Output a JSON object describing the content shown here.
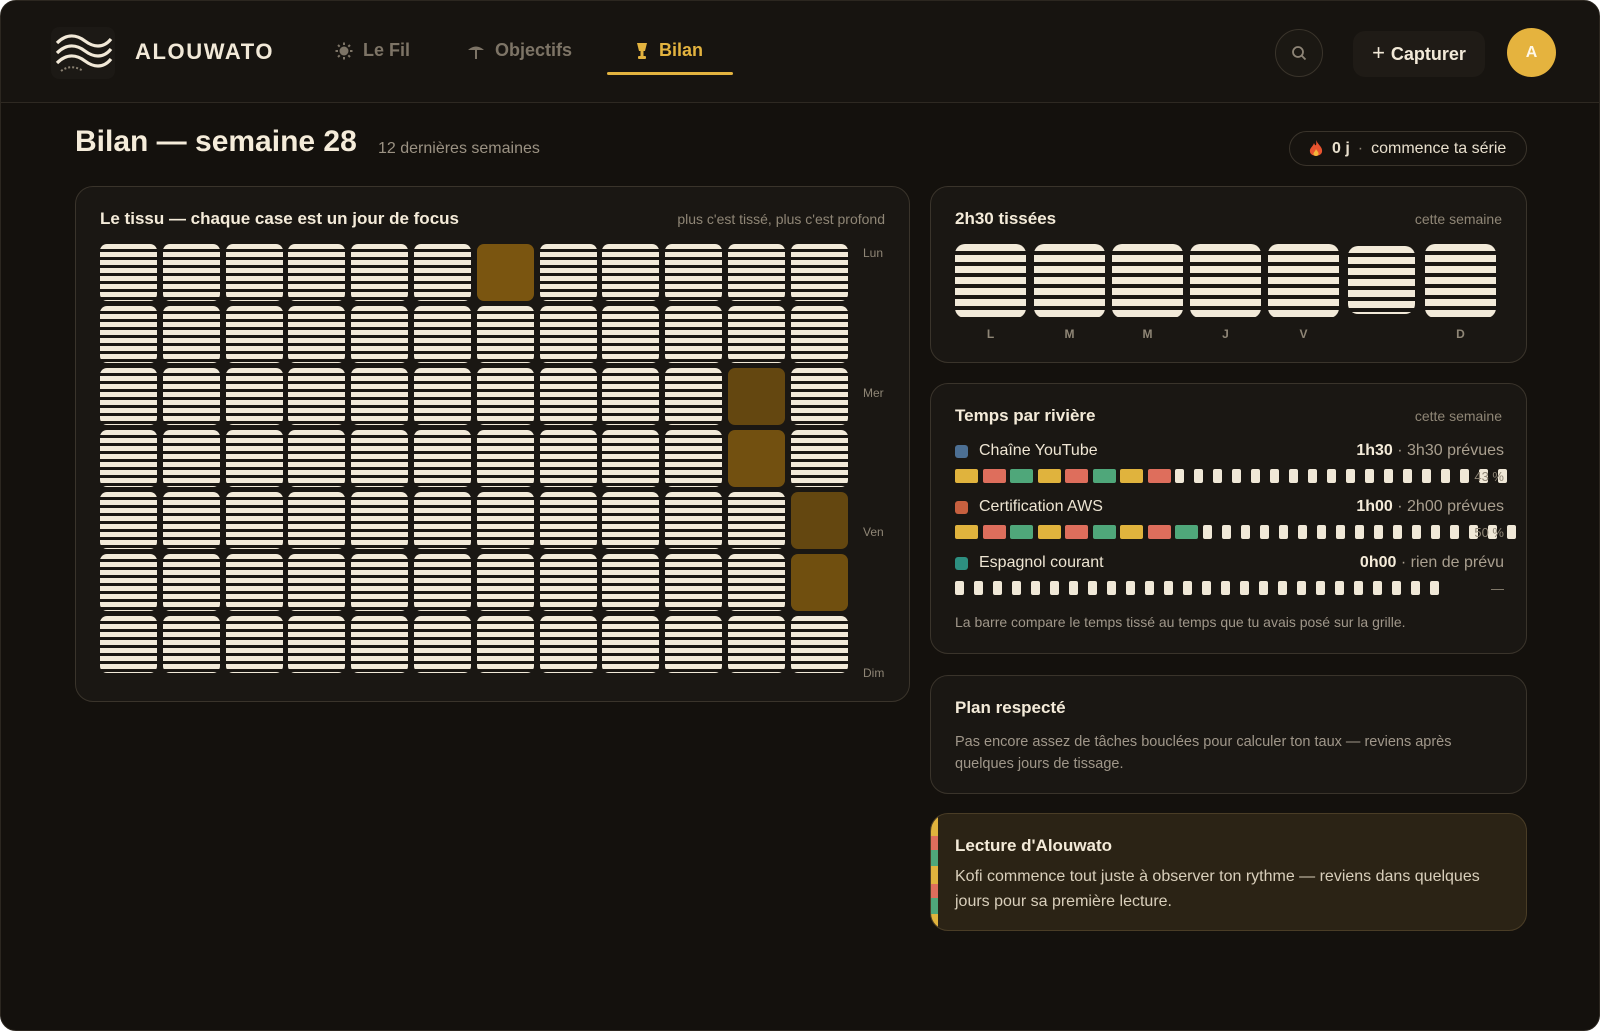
{
  "app": {
    "brand": "ALOUWATO"
  },
  "nav": {
    "items": [
      {
        "label": "Le Fil",
        "icon": "sun-icon"
      },
      {
        "label": "Objectifs",
        "icon": "umbrella-icon"
      },
      {
        "label": "Bilan",
        "icon": "chalice-icon",
        "active": true
      }
    ]
  },
  "header": {
    "capture_label": "Capturer",
    "capture_plus": "+",
    "avatar_initial": "A"
  },
  "page": {
    "title": "Bilan — semaine 28",
    "subtitle": "12 dernières semaines"
  },
  "streak": {
    "days": "0 j",
    "separator": "·",
    "text": "commence ta série"
  },
  "fabric": {
    "title": "Le tissu — chaque case est un jour de focus",
    "note": "plus c'est tissé, plus c'est profond",
    "day_labels": [
      "Lun",
      "Mer",
      "Ven",
      "Dim"
    ],
    "weeks": 12,
    "days": 7,
    "focus_days": [
      {
        "week": 7,
        "day": 1,
        "level": 1.0
      },
      {
        "week": 11,
        "day": 3,
        "level": 0.55
      },
      {
        "week": 11,
        "day": 4,
        "level": 0.85
      },
      {
        "week": 12,
        "day": 5,
        "level": 0.55
      },
      {
        "week": 12,
        "day": 6,
        "level": 0.8
      }
    ],
    "colors": {
      "woven": "#f2ead9",
      "focus": "#7a5510"
    }
  },
  "week": {
    "title": "2h30 tissées",
    "note": "cette semaine",
    "days": [
      {
        "label": "L"
      },
      {
        "label": "M"
      },
      {
        "label": "M"
      },
      {
        "label": "J"
      },
      {
        "label": "V"
      },
      {
        "label": ""
      },
      {
        "label": "D"
      }
    ]
  },
  "rivers": {
    "title": "Temps par rivière",
    "note": "cette semaine",
    "items": [
      {
        "name": "Chaîne YouTube",
        "done": "1h30",
        "sep": " · ",
        "plan": "3h30 prévues",
        "pct": "43 %",
        "color": "#4c6f93",
        "filled": 8
      },
      {
        "name": "Certification AWS",
        "done": "1h00",
        "sep": " · ",
        "plan": "2h00 prévues",
        "pct": "50 %",
        "color": "#c7603f",
        "filled": 9
      },
      {
        "name": "Espagnol courant",
        "done": "0h00",
        "sep": " · ",
        "plan": "rien de prévu",
        "pct": "—",
        "color": "#2d8f80",
        "filled": 0
      }
    ],
    "segment_colors": [
      "#e0b33d",
      "#de6e5c",
      "#4fa77a"
    ],
    "total_segments": 26,
    "footnote": "La barre compare le temps tissé au temps que tu avais posé sur la grille."
  },
  "plan": {
    "title": "Plan respecté",
    "text": "Pas encore assez de tâches bouclées pour calculer ton taux — reviens après quelques jours de tissage."
  },
  "reading": {
    "title": "Lecture d'Alouwato",
    "text": "Kofi commence tout juste à observer ton rythme — reviens dans quelques jours pour sa première lecture."
  }
}
